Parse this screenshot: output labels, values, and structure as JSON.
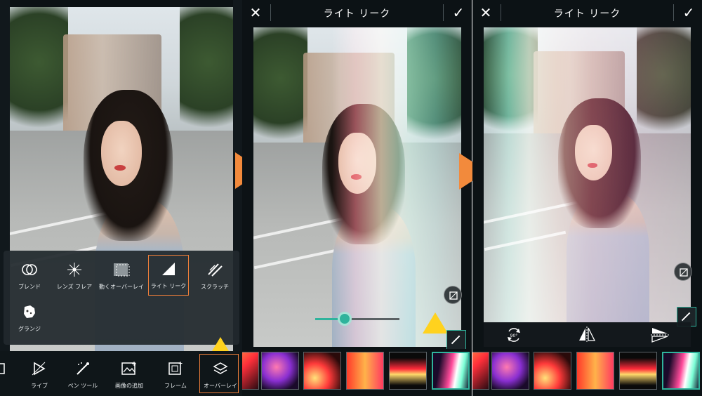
{
  "panel1": {
    "tools": [
      {
        "label": "ブレンド",
        "icon": "blend-icon"
      },
      {
        "label": "レンズ フレア",
        "icon": "lens-flare-icon"
      },
      {
        "label": "動くオーバーレイ",
        "icon": "moving-overlay-icon"
      },
      {
        "label": "ライト リーク",
        "icon": "light-leak-icon",
        "selected": true
      },
      {
        "label": "スクラッチ",
        "icon": "scratch-icon"
      },
      {
        "label": "グランジ",
        "icon": "grunge-icon"
      }
    ],
    "nav": [
      {
        "label": "ー",
        "icon": "partial-icon"
      },
      {
        "label": "ライブ",
        "icon": "live-icon"
      },
      {
        "label": "ペン ツール",
        "icon": "pen-tool-icon"
      },
      {
        "label": "画像の追加",
        "icon": "add-image-icon"
      },
      {
        "label": "フレーム",
        "icon": "frame-icon"
      },
      {
        "label": "オーバーレイ",
        "icon": "overlay-icon",
        "selected": true
      }
    ]
  },
  "panel2": {
    "title": "ライト リーク",
    "close_icon": "close-icon",
    "confirm_icon": "check-icon",
    "slider_value": 0.35,
    "thumb_count_visible": 5
  },
  "panel3": {
    "title": "ライト リーク",
    "close_icon": "close-icon",
    "confirm_icon": "check-icon",
    "actions": [
      {
        "icon": "rotate-90-icon"
      },
      {
        "icon": "flip-horizontal-icon"
      },
      {
        "icon": "flip-vertical-icon"
      }
    ]
  },
  "colors": {
    "accent_orange": "#f07f3a",
    "accent_teal": "#2fb39c",
    "pointer_yellow": "#ffd21e",
    "arrow_orange": "#f28a3c"
  }
}
